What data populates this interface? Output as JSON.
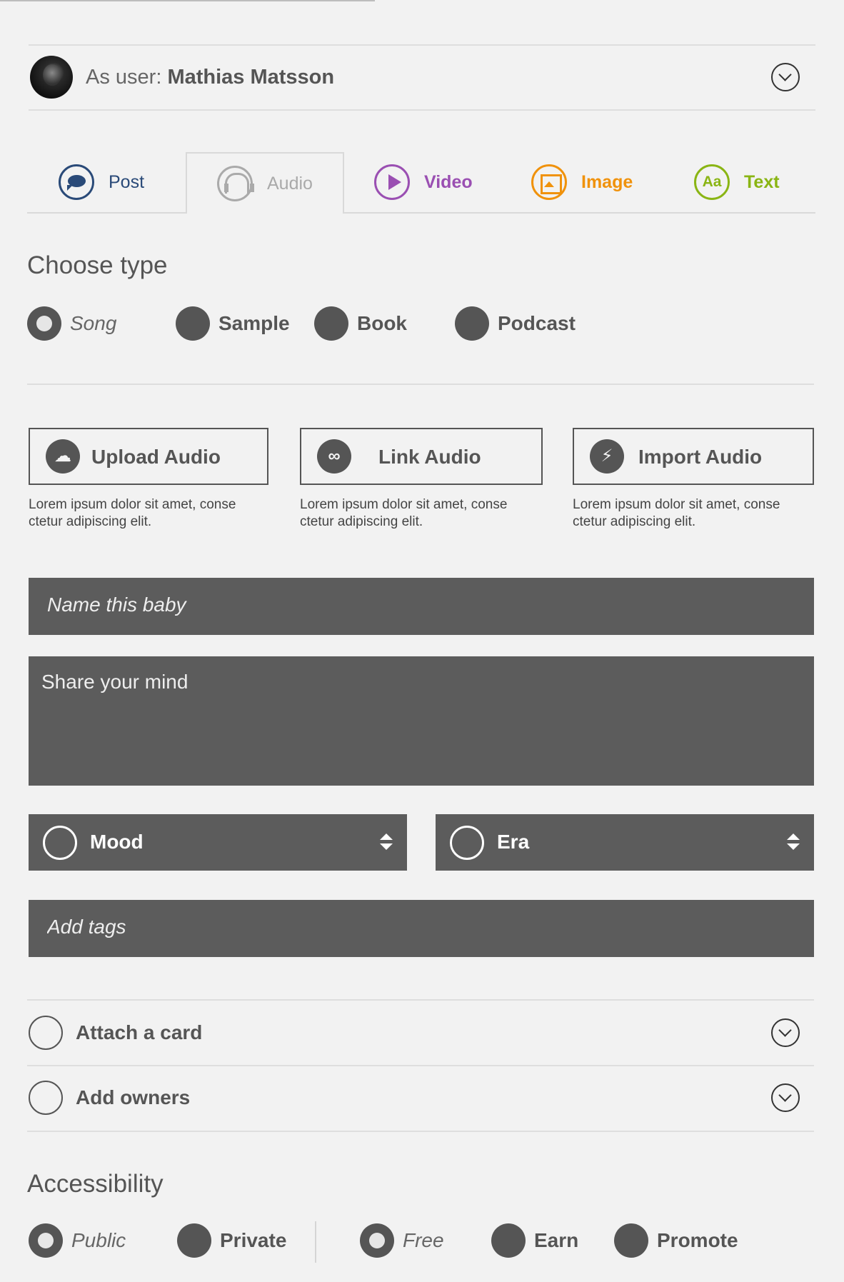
{
  "user": {
    "prefix": "As user: ",
    "name": "Mathias Matsson"
  },
  "tabs": [
    {
      "label": "Post",
      "color": "#2a4a78",
      "icon": "chat-bubble-icon"
    },
    {
      "label": "Audio",
      "color": "#aaaaaa",
      "icon": "headphones-icon",
      "active": true
    },
    {
      "label": "Video",
      "color": "#9a4fb2",
      "icon": "play-icon"
    },
    {
      "label": "Image",
      "color": "#f0920c",
      "icon": "image-icon"
    },
    {
      "label": "Text",
      "color": "#8ab514",
      "icon": "text-aa-icon",
      "glyph": "Aa"
    }
  ],
  "choose_type": {
    "title": "Choose type",
    "options": [
      {
        "label": "Song",
        "selected": true
      },
      {
        "label": "Sample",
        "selected": false
      },
      {
        "label": "Book",
        "selected": false
      },
      {
        "label": "Podcast",
        "selected": false
      }
    ]
  },
  "audio_sources": [
    {
      "label": "Upload Audio",
      "icon": "cloud-upload-icon",
      "description": "Lorem ipsum dolor sit amet, conse ctetur adipiscing elit."
    },
    {
      "label": "Link Audio",
      "icon": "link-icon",
      "description": "Lorem ipsum dolor sit amet, conse ctetur adipiscing elit."
    },
    {
      "label": "Import Audio",
      "icon": "plug-icon",
      "description": "Lorem ipsum dolor sit amet, conse ctetur adipiscing elit."
    }
  ],
  "form": {
    "name_placeholder": "Name this baby",
    "mind_placeholder": "Share your mind",
    "tags_placeholder": "Add tags",
    "mood_label": "Mood",
    "era_label": "Era"
  },
  "sections": {
    "attach_card": "Attach a card",
    "add_owners": "Add owners"
  },
  "accessibility": {
    "title": "Accessibility",
    "visibility": [
      {
        "label": "Public",
        "selected": true
      },
      {
        "label": "Private",
        "selected": false
      }
    ],
    "pricing": [
      {
        "label": "Free",
        "selected": true
      },
      {
        "label": "Earn",
        "selected": false
      },
      {
        "label": "Promote",
        "selected": false
      }
    ]
  },
  "colors": {
    "background": "#f2f2f2",
    "field": "#5c5c5c",
    "text": "#555555"
  }
}
